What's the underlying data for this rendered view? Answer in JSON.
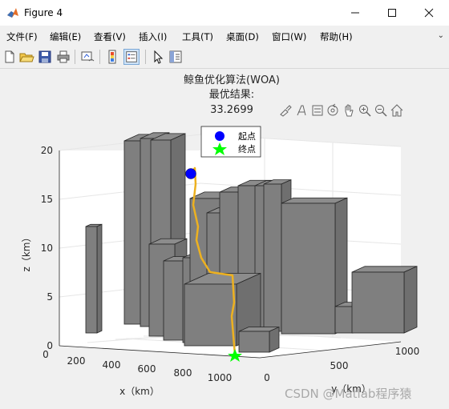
{
  "window": {
    "title": "Figure 4",
    "minimize": "—",
    "maximize": "☐",
    "close": "✕"
  },
  "menu": {
    "items": [
      "文件(F)",
      "编辑(E)",
      "查看(V)",
      "插入(I)",
      "工具(T)",
      "桌面(D)",
      "窗口(W)",
      "帮助(H)"
    ],
    "overflow": "⌄"
  },
  "toolbar": {
    "icons": [
      "new-figure-icon",
      "open-file-icon",
      "save-icon",
      "print-icon",
      "link-plot-icon",
      "colorbar-icon",
      "legend-icon",
      "pointer-icon",
      "property-inspector-icon"
    ]
  },
  "axes_toolbar": {
    "icons": [
      "brush-icon",
      "data-tips-icon",
      "plot-edit-icon",
      "rotate-3d-icon",
      "pan-icon",
      "zoom-in-icon",
      "zoom-out-icon",
      "home-icon"
    ]
  },
  "chart_data": {
    "type": "3d-bar-path",
    "title_lines": [
      "鲸鱼优化算法(WOA)",
      "最优结果:",
      "33.2699"
    ],
    "xlabel": "x（km）",
    "ylabel": "y（km）",
    "zlabel": "z（km）",
    "xticks": [
      "0",
      "200",
      "400",
      "600",
      "800",
      "1000"
    ],
    "yticks": [
      "0",
      "500",
      "1000"
    ],
    "zticks": [
      "0",
      "5",
      "10",
      "15",
      "20"
    ],
    "zlim": [
      0,
      20
    ],
    "legend": {
      "entries": [
        {
          "label": "起点",
          "marker": "circle",
          "color": "#0000ff"
        },
        {
          "label": "终点",
          "marker": "star",
          "color": "#00ff00"
        }
      ],
      "location": "top"
    },
    "path_color": "#edb120",
    "bar_color": "#7f7f7f",
    "start_point": {
      "z": 17.5
    },
    "end_point": {
      "z": 0
    }
  },
  "watermark": "CSDN @Matlab程序猿"
}
